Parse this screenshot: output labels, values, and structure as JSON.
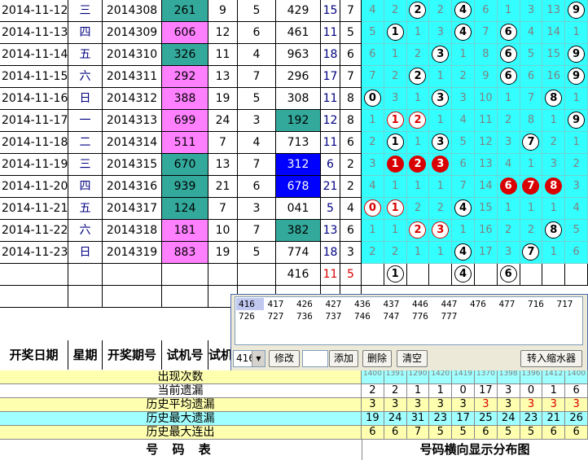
{
  "rows": [
    {
      "date": "2014-11-12",
      "week": "三",
      "issue": "2014308",
      "trial": "261",
      "a": "9",
      "b": "5",
      "draw": "429",
      "s": "15",
      "k": "7",
      "dist": [
        "4",
        "2",
        "●2",
        "2",
        "●4",
        "6",
        "1",
        "3",
        "13",
        "●9"
      ]
    },
    {
      "date": "2014-11-13",
      "week": "四",
      "issue": "2014309",
      "trial": "606",
      "a": "12",
      "b": "6",
      "draw": "461",
      "s": "11",
      "k": "5",
      "dist": [
        "5",
        "●1",
        "1",
        "3",
        "●4",
        "7",
        "●6",
        "4",
        "14",
        "1"
      ]
    },
    {
      "date": "2014-11-14",
      "week": "五",
      "issue": "2014310",
      "trial": "326",
      "a": "11",
      "b": "4",
      "draw": "963",
      "s": "18",
      "k": "6",
      "dist": [
        "6",
        "1",
        "2",
        "●3",
        "1",
        "8",
        "●6",
        "5",
        "15",
        "●9"
      ]
    },
    {
      "date": "2014-11-15",
      "week": "六",
      "issue": "2014311",
      "trial": "292",
      "a": "13",
      "b": "7",
      "draw": "296",
      "s": "17",
      "k": "7",
      "dist": [
        "7",
        "2",
        "●2",
        "1",
        "2",
        "9",
        "●6",
        "6",
        "16",
        "●9"
      ]
    },
    {
      "date": "2014-11-16",
      "week": "日",
      "issue": "2014312",
      "trial": "388",
      "a": "19",
      "b": "5",
      "draw": "308",
      "s": "11",
      "k": "8",
      "dist": [
        "●0",
        "3",
        "1",
        "●3",
        "3",
        "10",
        "1",
        "7",
        "●8",
        "1"
      ]
    },
    {
      "date": "2014-11-17",
      "week": "一",
      "issue": "2014313",
      "trial": "699",
      "a": "24",
      "b": "3",
      "draw": "192",
      "s": "12",
      "k": "8",
      "dist": [
        "1",
        "○1",
        "○2",
        "1",
        "4",
        "11",
        "2",
        "8",
        "1",
        "●9"
      ]
    },
    {
      "date": "2014-11-18",
      "week": "二",
      "issue": "2014314",
      "trial": "511",
      "a": "7",
      "b": "4",
      "draw": "713",
      "s": "11",
      "k": "6",
      "dist": [
        "2",
        "●1",
        "1",
        "●3",
        "5",
        "12",
        "3",
        "●7",
        "2",
        "1"
      ]
    },
    {
      "date": "2014-11-19",
      "week": "三",
      "issue": "2014315",
      "trial": "670",
      "a": "13",
      "b": "7",
      "draw": "312",
      "s": "6",
      "k": "2",
      "dist": [
        "3",
        "◆1",
        "◆2",
        "◆3",
        "6",
        "13",
        "4",
        "1",
        "3",
        "2"
      ]
    },
    {
      "date": "2014-11-20",
      "week": "四",
      "issue": "2014316",
      "trial": "939",
      "a": "21",
      "b": "6",
      "draw": "678",
      "s": "21",
      "k": "2",
      "dist": [
        "4",
        "1",
        "1",
        "1",
        "7",
        "14",
        "◆6",
        "◆7",
        "◆8",
        "3"
      ]
    },
    {
      "date": "2014-11-21",
      "week": "五",
      "issue": "2014317",
      "trial": "124",
      "a": "7",
      "b": "3",
      "draw": "041",
      "s": "5",
      "k": "4",
      "dist": [
        "○0",
        "○1",
        "2",
        "2",
        "●4",
        "15",
        "1",
        "1",
        "1",
        "4"
      ]
    },
    {
      "date": "2014-11-22",
      "week": "六",
      "issue": "2014318",
      "trial": "181",
      "a": "10",
      "b": "7",
      "draw": "382",
      "s": "13",
      "k": "6",
      "dist": [
        "1",
        "1",
        "○2",
        "○3",
        "1",
        "16",
        "2",
        "2",
        "●8",
        "5"
      ]
    },
    {
      "date": "2014-11-23",
      "week": "日",
      "issue": "2014319",
      "trial": "883",
      "a": "19",
      "b": "5",
      "draw": "774",
      "s": "18",
      "k": "3",
      "dist": [
        "2",
        "2",
        "1",
        "1",
        "●4",
        "17",
        "3",
        "●7",
        "1",
        "6"
      ]
    }
  ],
  "trial_row": {
    "draw": "416",
    "s": "11",
    "k": "5",
    "dist": [
      "",
      "●1",
      "",
      "",
      "●4",
      "",
      "●6",
      "",
      "",
      ""
    ]
  },
  "headers": {
    "date": "开奖日期",
    "week": "星期",
    "issue": "开奖期号",
    "trial": "试机号",
    "extra": "试机"
  },
  "popup": {
    "combos": [
      [
        "416",
        "417",
        "426",
        "427",
        "436",
        "437",
        "446",
        "447",
        "476",
        "477",
        "716",
        "717"
      ],
      [
        "726",
        "727",
        "736",
        "737",
        "746",
        "747",
        "776",
        "777"
      ]
    ],
    "select_value": "416",
    "modify_label": "修改",
    "add_label": "添加",
    "delete_label": "删除",
    "clear_label": "清空",
    "shrink_label": "转入缩水器"
  },
  "stats": [
    {
      "label": "出现次数",
      "values": [
        "1400",
        "1391",
        "1290",
        "1420",
        "1419",
        "1370",
        "1398",
        "1396",
        "1412",
        "1400"
      ]
    },
    {
      "label": "当前遗漏",
      "values": [
        "2",
        "2",
        "1",
        "1",
        "0",
        "17",
        "3",
        "0",
        "1",
        "6"
      ]
    },
    {
      "label": "历史平均遗漏",
      "values": [
        "3",
        "3",
        "3",
        "3",
        "3",
        "3",
        "3",
        "3",
        "3",
        "3"
      ]
    },
    {
      "label": "历史最大遗漏",
      "values": [
        "19",
        "24",
        "31",
        "23",
        "17",
        "25",
        "24",
        "23",
        "21",
        "26"
      ]
    },
    {
      "label": "历史最大连出",
      "values": [
        "6",
        "6",
        "7",
        "5",
        "5",
        "6",
        "5",
        "5",
        "6",
        "6"
      ]
    }
  ],
  "footer": {
    "left": "号 码 表",
    "right": "号码横向显示分布图"
  },
  "colors": {
    "pink": "#ff80ff",
    "teal": "#33a99c",
    "cyan": "#33ffff",
    "blue": "#0000ff",
    "yellow": "#ffffb0",
    "lightcyan": "#a0ffff"
  }
}
